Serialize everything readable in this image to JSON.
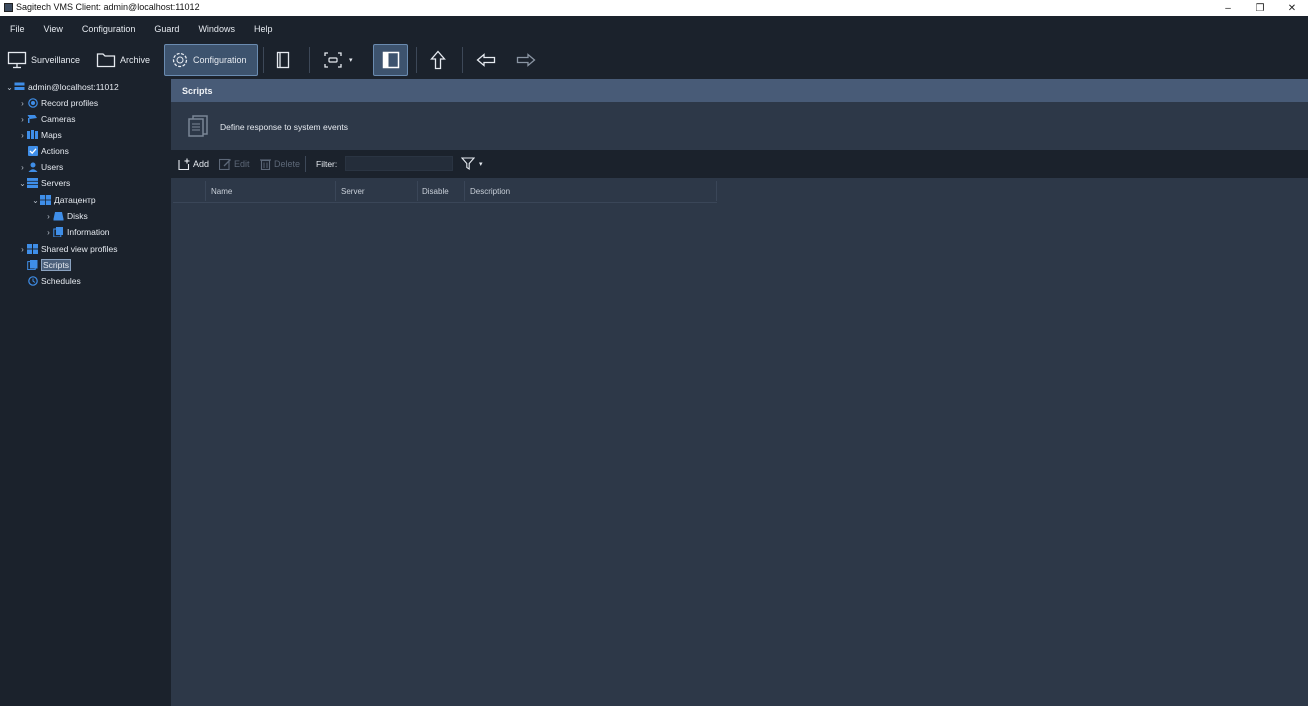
{
  "window": {
    "title": "Sagitech VMS Client: admin@localhost:11012",
    "controls": [
      "–",
      "❐",
      "✕"
    ]
  },
  "menu": [
    "File",
    "View",
    "Configuration",
    "Guard",
    "Windows",
    "Help"
  ],
  "toolbar": {
    "surveillance": "Surveillance",
    "archive": "Archive",
    "configuration": "Configuration",
    "dropdown_arrow": "▾"
  },
  "tree": {
    "root": "admin@localhost:11012",
    "items": {
      "record_profiles": "Record profiles",
      "cameras": "Cameras",
      "maps": "Maps",
      "actions": "Actions",
      "users": "Users",
      "servers": "Servers",
      "datacenter": "Датацентр",
      "disks": "Disks",
      "information": "Information",
      "shared_view_profiles": "Shared view profiles",
      "scripts": "Scripts",
      "schedules": "Schedules"
    },
    "selected": "Scripts"
  },
  "main": {
    "section_title": "Scripts",
    "description": "Define response to system events",
    "commands": {
      "add": "Add",
      "edit": "Edit",
      "delete": "Delete",
      "filter_label": "Filter:",
      "filter_value": "",
      "filter_dropdown": "▾"
    },
    "columns": [
      "Name",
      "Server",
      "Disable",
      "Description"
    ]
  },
  "colors": {
    "background": "#2d3848",
    "panel": "#1b222c",
    "header": "#485b77",
    "active_button": "#3d536e",
    "accent_blue": "#3f8ee8"
  }
}
